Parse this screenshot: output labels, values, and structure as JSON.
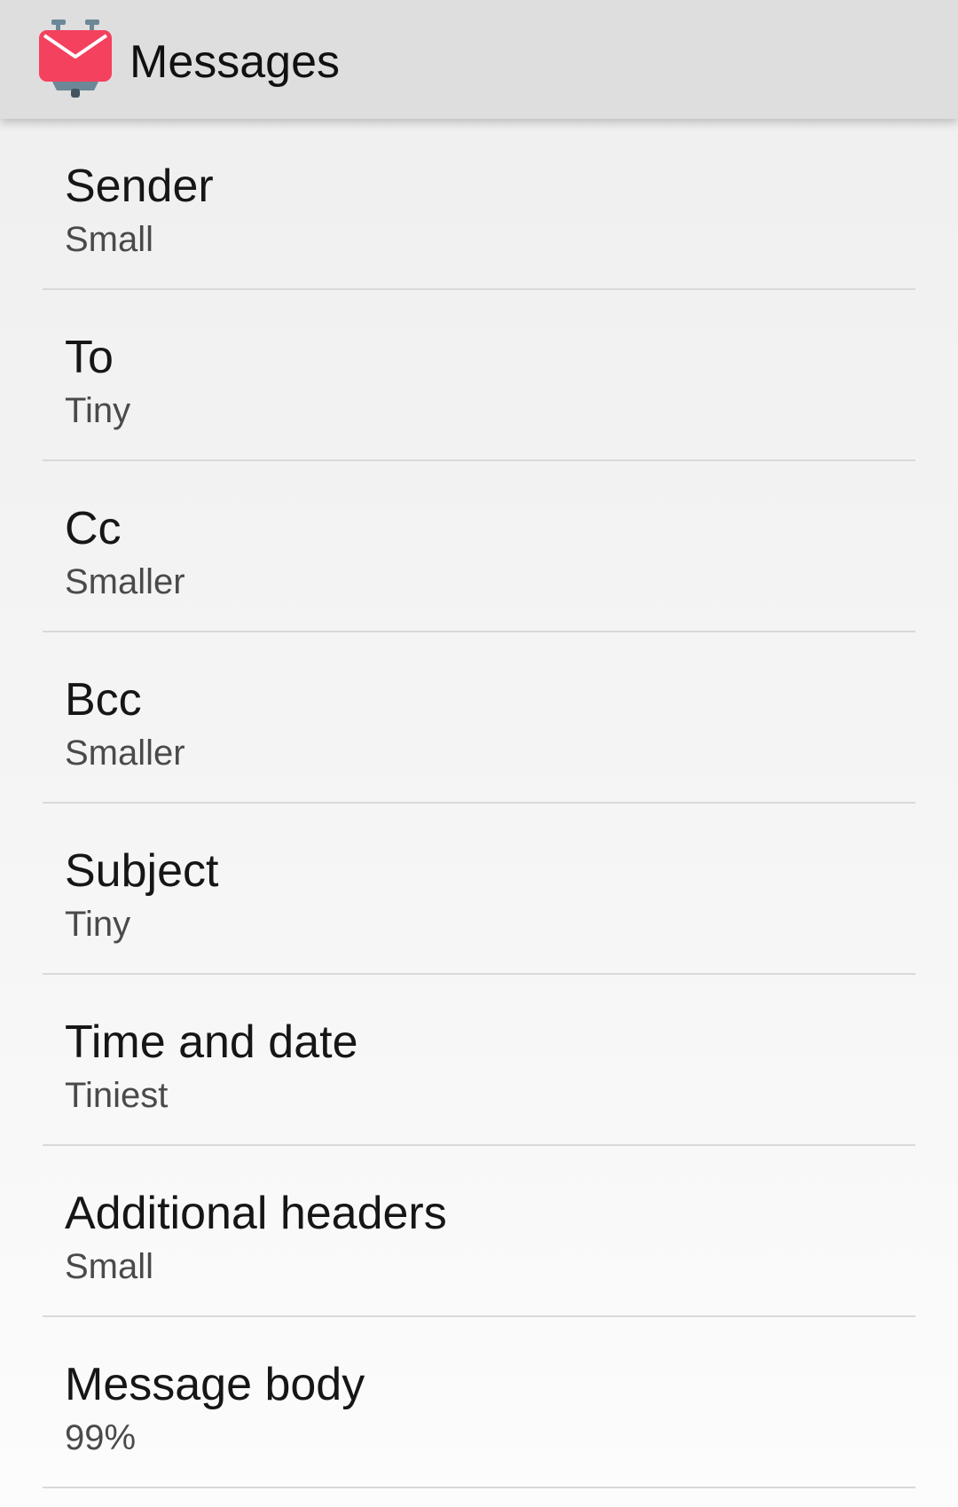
{
  "app_bar": {
    "title": "Messages",
    "icon": "k9-mail-robot-icon",
    "accent_color": "#f4415e"
  },
  "settings": [
    {
      "title": "Sender",
      "summary": "Small"
    },
    {
      "title": "To",
      "summary": "Tiny"
    },
    {
      "title": "Cc",
      "summary": "Smaller"
    },
    {
      "title": "Bcc",
      "summary": "Smaller"
    },
    {
      "title": "Subject",
      "summary": "Tiny"
    },
    {
      "title": "Time and date",
      "summary": "Tiniest"
    },
    {
      "title": "Additional headers",
      "summary": "Small"
    },
    {
      "title": "Message body",
      "summary": "99%"
    }
  ]
}
